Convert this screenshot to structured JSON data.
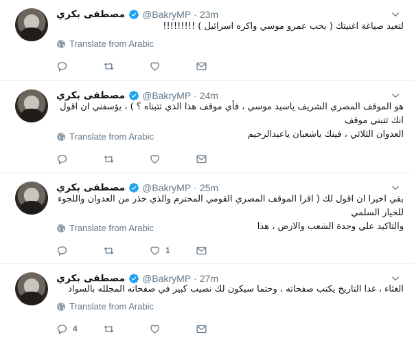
{
  "author": {
    "name": "مصطفى بكري",
    "handle": "@BakryMP",
    "separator": "·"
  },
  "translate_label": "Translate from Arabic",
  "tweets": [
    {
      "time": "23m",
      "lines": [
        "لتعيد صياغة اغنيتك ( بحب عمرو موسي واكره اسرائيل ) !!!!!!!!!"
      ],
      "counts": {
        "reply": "",
        "retweet": "",
        "like": ""
      }
    },
    {
      "time": "24m",
      "lines": [
        "هو الموقف المصري الشريف ياسيد موسي ، فأي موقف هذا الذي تتبناه ؟ ) ، يؤسفني ان اقول انك تتبني موقف",
        "العدوان الثلاثي ، فينك ياشعبان ياعبدالرحيم"
      ],
      "counts": {
        "reply": "",
        "retweet": "",
        "like": ""
      }
    },
    {
      "time": "25m",
      "lines": [
        "بقي اخيرا ان اقول لك ( اقرا الموقف المصري القومي المحترم والذي حذر من العدوان واللجوء للخيار السلمي",
        "والتاكيد علي وحدة الشعب والارض ، هذا"
      ],
      "counts": {
        "reply": "",
        "retweet": "",
        "like": "1"
      }
    },
    {
      "time": "27m",
      "lines": [
        "الغثاء ، غدا التاريخ يكتب صفحاته ، وحتما سيكون لك نصيب كبير في صفحاته المجلله بالسواد"
      ],
      "counts": {
        "reply": "4",
        "retweet": "",
        "like": ""
      }
    }
  ]
}
